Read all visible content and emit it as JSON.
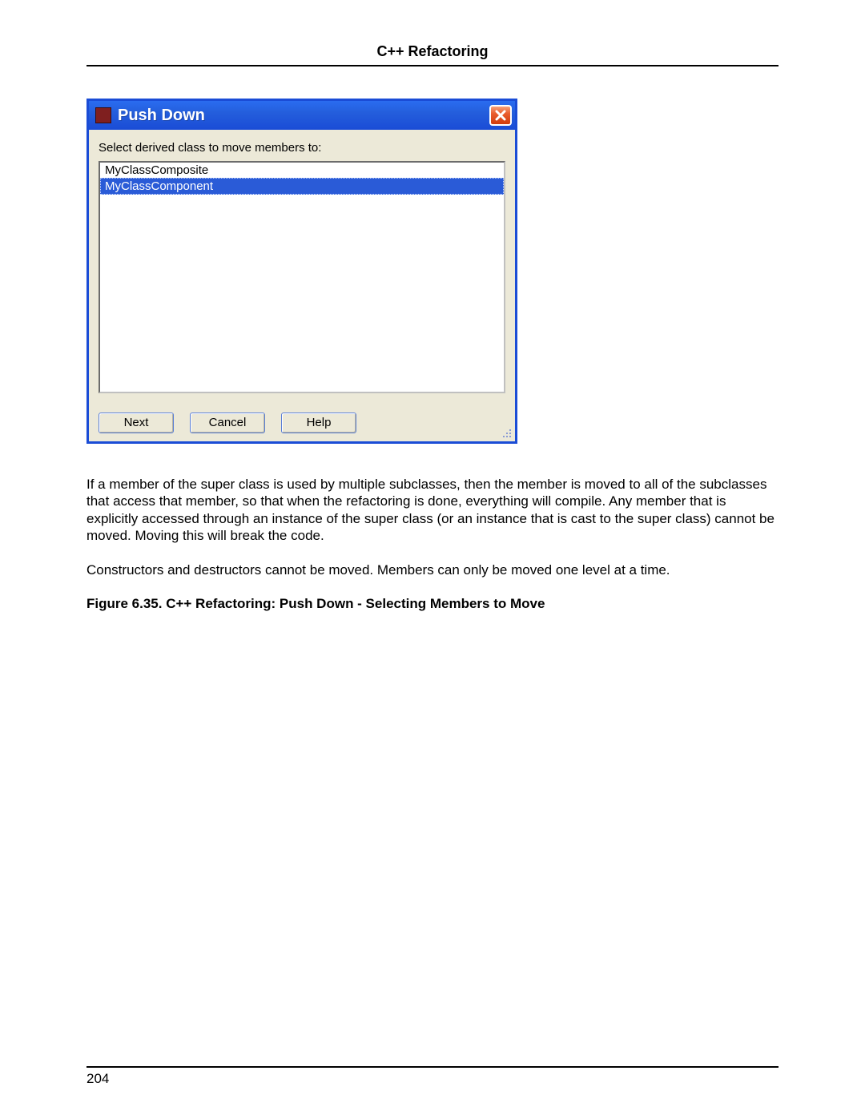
{
  "header": {
    "title": "C++ Refactoring"
  },
  "dialog": {
    "title": "Push Down",
    "instruction": "Select derived class to move members to:",
    "items": [
      {
        "label": "MyClassComposite",
        "selected": false
      },
      {
        "label": "MyClassComponent",
        "selected": true
      }
    ],
    "buttons": {
      "next": "Next",
      "cancel": "Cancel",
      "help": "Help"
    }
  },
  "paragraphs": {
    "p1": "If a member of the super class is used by multiple subclasses, then the member is moved to all of the subclasses that access that member, so that when the refactoring is done, everything will compile. Any member that is explicitly accessed through an instance of the super class (or an instance that is cast to the super class) cannot be moved. Moving this will break the code.",
    "p2": "Constructors and destructors cannot be moved. Members can only be moved one level at a time."
  },
  "figure": {
    "caption": "Figure 6.35.  C++ Refactoring: Push Down - Selecting Members to Move"
  },
  "footer": {
    "page_number": "204"
  }
}
